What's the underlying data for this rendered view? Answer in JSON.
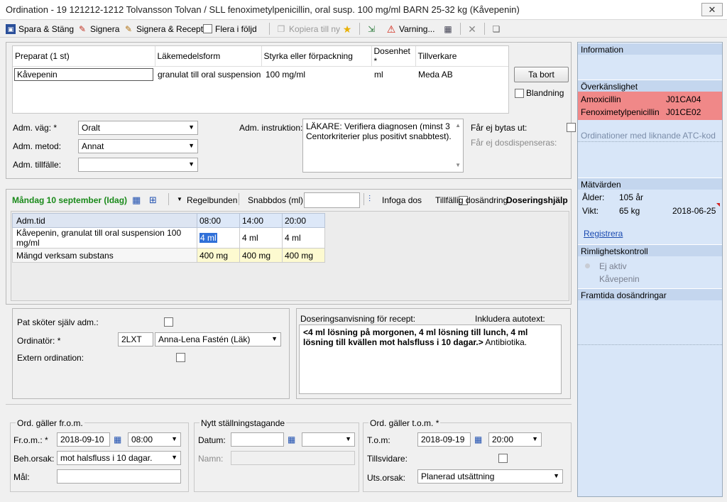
{
  "window": {
    "title": "Ordination - 19 121212-1212 Tolvansson Tolvan / SLL fenoximetylpenicillin, oral susp. 100 mg/ml BARN 25-32 kg (Kåvepenin)",
    "close": "✕"
  },
  "toolbar": {
    "save_close": "Spara & Stäng",
    "sign": "Signera",
    "sign_recipe": "Signera & Recept",
    "multiple": "Flera i följd",
    "copy": "Kopiera till ny",
    "warning": "Varning..."
  },
  "preparation": {
    "headers": [
      "Preparat (1 st)",
      "Läkemedelsform",
      "Styrka eller förpackning",
      "Dosenhet *",
      "Tillverkare"
    ],
    "row": [
      "Kåvepenin",
      "granulat till oral suspension",
      "100 mg/ml",
      "ml",
      "Meda AB"
    ],
    "remove": "Ta bort",
    "mix": "Blandning"
  },
  "admin": {
    "route_label": "Adm. väg: *",
    "route_value": "Oralt",
    "method_label": "Adm. metod:",
    "method_value": "Annat",
    "occasion_label": "Adm. tillfälle:",
    "occasion_value": "",
    "instruction_label": "Adm. instruktion:",
    "instruction_value": "LÄKARE: Verifiera diagnosen (minst 3 Centorkriterier plus positivt snabbtest).",
    "no_swap": "Får ej bytas ut:",
    "no_dosdisp": "Får ej dosdispenseras:"
  },
  "dosing": {
    "date": "Måndag 10 september (Idag)",
    "mode": "Regelbunden",
    "quick_label": "Snabbdos (ml):",
    "insert": "Infoga dos",
    "temp_change": "Tillfällig dosändring",
    "help": "Doseringshjälp",
    "grid_header": [
      "Adm.tid",
      "08:00",
      "14:00",
      "20:00"
    ],
    "grid_rows": [
      [
        "Kåvepenin, granulat till oral suspension 100 mg/ml",
        "4 ml",
        "4 ml",
        "4 ml"
      ],
      [
        "Mängd verksam substans",
        "400 mg",
        "400 mg",
        "400 mg"
      ]
    ]
  },
  "patient": {
    "self_admin": "Pat sköter själv adm.:",
    "prescriber_label": "Ordinatör: *",
    "prescriber_code": "2LXT",
    "prescriber_name": "Anna-Lena Fastén (Läk)",
    "external": "Extern ordination:"
  },
  "recipe": {
    "label": "Doseringsanvisning för recept:",
    "autotext": "Inkludera autotext:",
    "text_bold": "<4 ml lösning på morgonen, 4 ml lösning till lunch, 4 ml lösning till kvällen mot halsfluss i 10 dagar.>",
    "text_normal": " Antibiotika."
  },
  "from": {
    "group": "Ord. gäller fr.o.m.",
    "label": "Fr.o.m.: *",
    "date": "2018-09-10",
    "time": "08:00",
    "reason_label": "Beh.orsak:",
    "reason": "mot halsfluss i 10 dagar.",
    "goal_label": "Mål:"
  },
  "new_position": {
    "group": "Nytt ställningstagande",
    "date_label": "Datum:",
    "name_label": "Namn:"
  },
  "to": {
    "group": "Ord. gäller t.o.m. *",
    "label": "T.o.m:",
    "date": "2018-09-19",
    "time": "20:00",
    "until_label": "Tillsvidare:",
    "reason_label": "Uts.orsak:",
    "reason": "Planerad utsättning"
  },
  "sidebar": {
    "info": "Information",
    "allergy": "Överkänslighet",
    "allergy_rows": [
      [
        "Amoxicillin",
        "J01CA04"
      ],
      [
        "Fenoximetylpenicillin",
        "J01CE02"
      ]
    ],
    "similar": "Ordinationer med liknande ATC-kod",
    "measures": "Mätvärden",
    "age_label": "Ålder:",
    "age": "105 år",
    "weight_label": "Vikt:",
    "weight": "65 kg",
    "weight_date": "2018-06-25",
    "register": "Registrera",
    "plausibility": "Rimlighetskontroll",
    "inactive": "Ej aktiv",
    "inactive_drug": "Kåvepenin",
    "future": "Framtida dosändringar"
  }
}
